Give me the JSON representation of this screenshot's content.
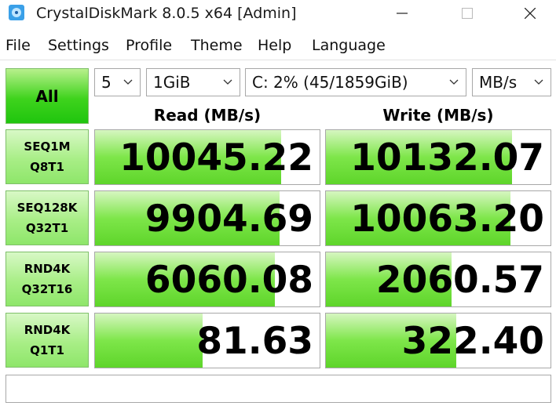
{
  "window": {
    "title": "CrystalDiskMark 8.0.5 x64 [Admin]",
    "icon": "crystaldiskmark-icon"
  },
  "menu": [
    "File",
    "Settings",
    "Profile",
    "Theme",
    "Help",
    "Language"
  ],
  "controls": {
    "all_label": "All",
    "count": "5",
    "size": "1GiB",
    "drive": "C: 2% (45/1859GiB)",
    "unit": "MB/s"
  },
  "headers": {
    "read": "Read (MB/s)",
    "write": "Write (MB/s)"
  },
  "tests": [
    {
      "line1": "SEQ1M",
      "line2": "Q8T1",
      "read": "10045.22",
      "write": "10132.07"
    },
    {
      "line1": "SEQ128K",
      "line2": "Q32T1",
      "read": "9904.69",
      "write": "10063.20"
    },
    {
      "line1": "RND4K",
      "line2": "Q32T16",
      "read": "6060.08",
      "write": "2060.57"
    },
    {
      "line1": "RND4K",
      "line2": "Q1T1",
      "read": "81.63",
      "write": "322.40"
    }
  ],
  "bar_fraction": {
    "read": [
      0.83,
      0.82,
      0.8,
      0.48
    ],
    "write": [
      0.83,
      0.82,
      0.56,
      0.58
    ]
  },
  "comment": "",
  "colors": {
    "accent_green": "#3fd31d",
    "border": "#a8a8a8"
  }
}
